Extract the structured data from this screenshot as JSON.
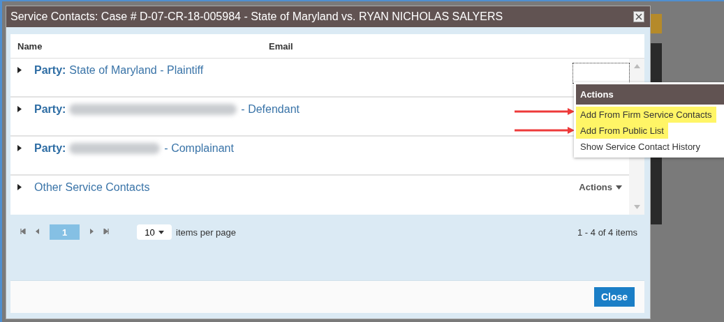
{
  "dialog": {
    "title": "Service Contacts: Case # D-07-CR-18-005984 - State of Maryland vs. RYAN NICHOLAS SALYERS",
    "columns": [
      "Name",
      "Email"
    ],
    "rows": [
      {
        "kind": "party",
        "label": "Party:",
        "name": "State of Maryland - Plaintiff",
        "name_blurred": false,
        "expanded": false
      },
      {
        "kind": "party",
        "label": "Party:",
        "name": "- Defendant",
        "name_blurred": true,
        "expanded": false
      },
      {
        "kind": "party",
        "label": "Party:",
        "name": "- Complainant",
        "name_blurred": true,
        "expanded": false
      },
      {
        "kind": "group",
        "name": "Other Service Contacts",
        "actions": "Actions",
        "expanded": false
      }
    ],
    "pager": {
      "pages": [
        {
          "label": "1",
          "selected": true
        }
      ],
      "page_size": "10",
      "page_size_label": "items per page",
      "summary": "1 - 4 of 4 items"
    },
    "buttons": [
      "Close"
    ]
  },
  "menu": {
    "title": "Actions",
    "items": [
      {
        "label": "Add From Firm Service Contacts",
        "highlighted": true
      },
      {
        "label": "Add From Public List",
        "highlighted": true
      },
      {
        "label": "Show Service Contact History",
        "highlighted": false
      }
    ]
  }
}
